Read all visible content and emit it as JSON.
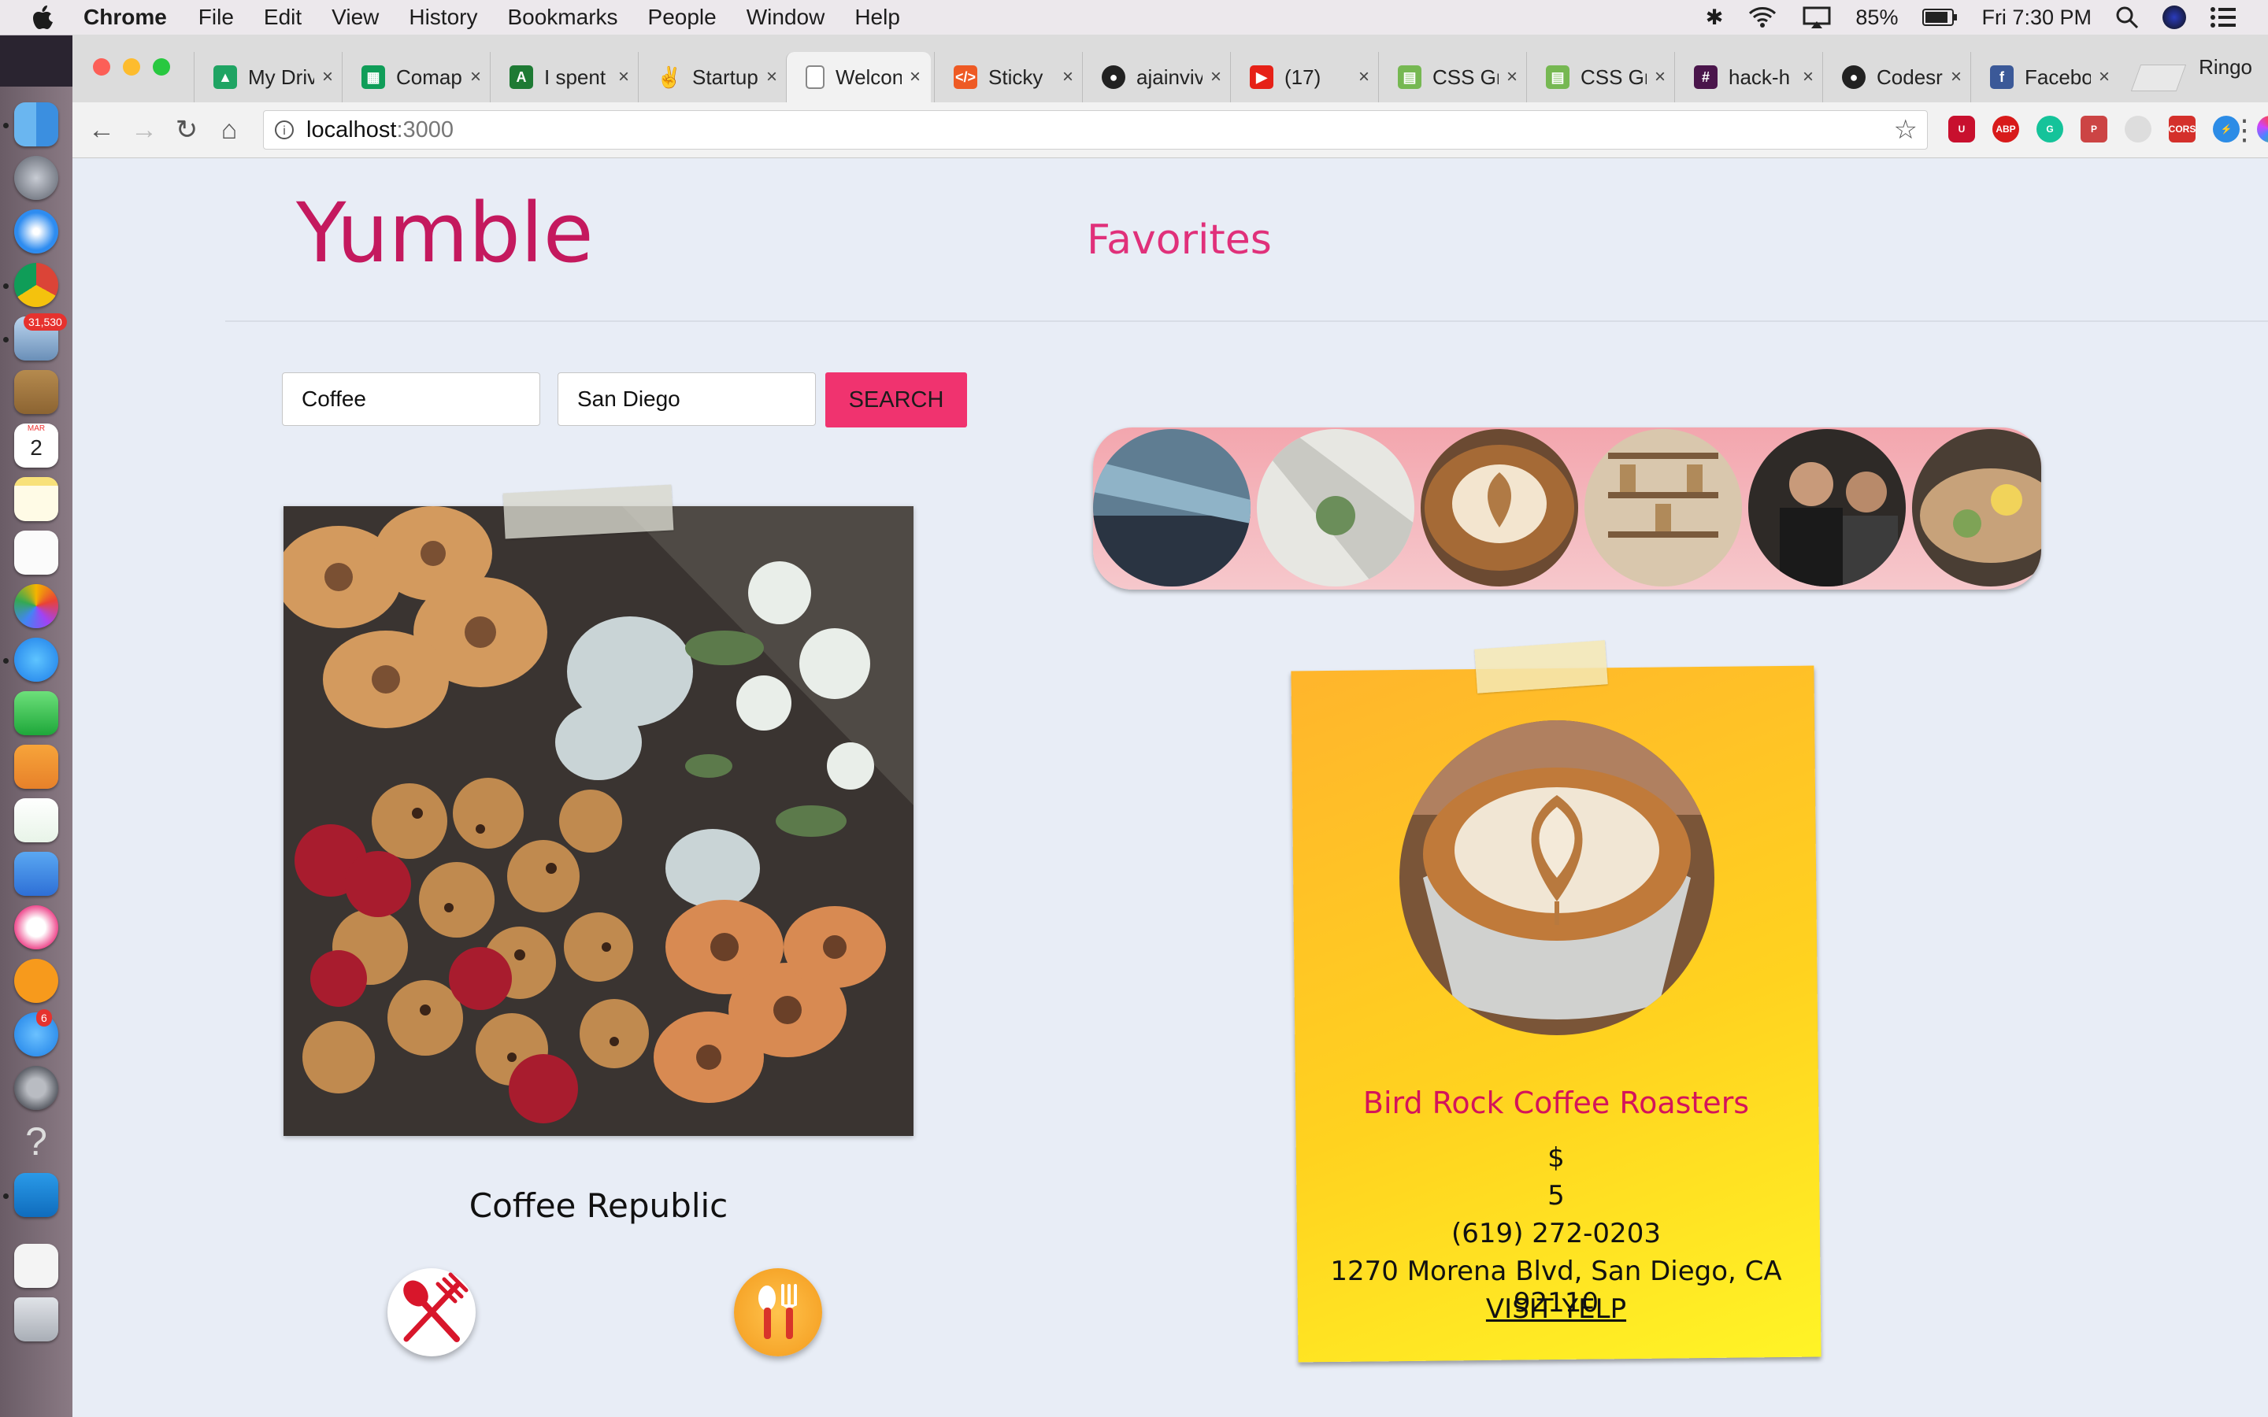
{
  "menubar": {
    "app_name": "Chrome",
    "menus": [
      "File",
      "Edit",
      "View",
      "History",
      "Bookmarks",
      "People",
      "Window",
      "Help"
    ],
    "battery": "85%",
    "clock": "Fri 7:30 PM"
  },
  "dock": {
    "badges": {
      "mail": "31,530",
      "calendar_month": "MAR",
      "calendar_day": "2",
      "appstore": "6"
    }
  },
  "browser": {
    "tabs": [
      {
        "label": "My Driv",
        "icon": "google-drive-icon",
        "color": "#1fa463"
      },
      {
        "label": "Comap",
        "icon": "google-sheets-icon",
        "color": "#0f9d58"
      },
      {
        "label": "I spent",
        "icon": "page-icon",
        "color": "#1e7a34"
      },
      {
        "label": "Startup",
        "icon": "peace-hand-icon",
        "color": "#777777"
      },
      {
        "label": "Welcon",
        "icon": "document-icon",
        "color": "#888888"
      },
      {
        "label": "Sticky",
        "icon": "shield-icon",
        "color": "#ee5a24"
      },
      {
        "label": "ajainviv",
        "icon": "github-icon",
        "color": "#222222"
      },
      {
        "label": "(17)",
        "icon": "youtube-icon",
        "color": "#e62117"
      },
      {
        "label": "CSS Gr",
        "icon": "css-icon",
        "color": "#76b852"
      },
      {
        "label": "CSS Gr",
        "icon": "css-icon",
        "color": "#76b852"
      },
      {
        "label": "hack-h",
        "icon": "slack-hash-icon",
        "color": "#4a154b"
      },
      {
        "label": "Codesr",
        "icon": "github-icon",
        "color": "#222222"
      },
      {
        "label": "Facebo",
        "icon": "facebook-icon",
        "color": "#3b5998"
      }
    ],
    "profile_name": "Ringo",
    "url_host": "localhost",
    "url_port": ":3000"
  },
  "page": {
    "logo": "Yumble",
    "favorites_link": "Favorites",
    "search": {
      "term": "Coffee",
      "location": "San Diego",
      "button_label": "SEARCH"
    },
    "current_restaurant": {
      "name": "Coffee Republic"
    },
    "favorite_card": {
      "name": "Bird Rock Coffee Roasters",
      "price": "$",
      "rating": "5",
      "phone": "(619) 272-0203",
      "address": "1270 Morena Blvd, San Diego, CA 92110",
      "link_label": "VISIT YELP"
    },
    "colors": {
      "brand": "#c4195e",
      "accent": "#f0336f",
      "background": "#e8edf6"
    }
  }
}
